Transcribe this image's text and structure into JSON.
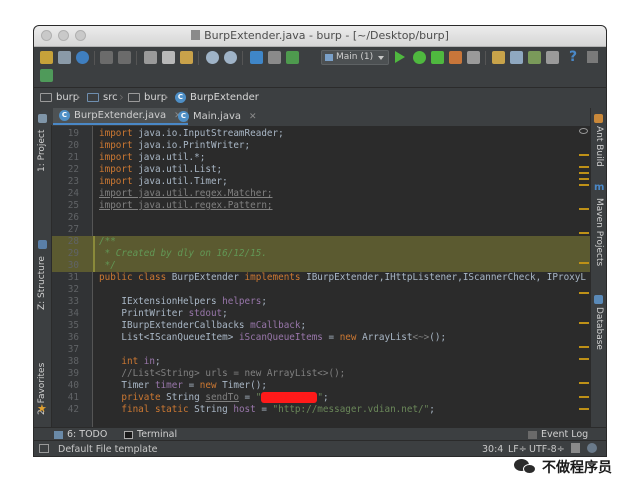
{
  "window": {
    "title": "BurpExtender.java - burp - [~/Desktop/burp]"
  },
  "toolbar": {
    "run_config": "Main (1)"
  },
  "breadcrumbs": [
    "burp",
    "src",
    "burp",
    "BurpExtender"
  ],
  "tabs": [
    {
      "label": "BurpExtender.java",
      "active": true
    },
    {
      "label": "Main.java",
      "active": false
    }
  ],
  "left_tools": {
    "project": "1: Project",
    "structure": "Z: Structure",
    "favorites": "2: Favorites"
  },
  "right_tools": {
    "ant": "Ant Build",
    "maven": "Maven Projects",
    "database": "Database"
  },
  "code_lines": [
    {
      "n": "19",
      "segs": [
        [
          "kw",
          "import "
        ],
        [
          "",
          "java.io.InputStreamReader;"
        ]
      ]
    },
    {
      "n": "20",
      "segs": [
        [
          "kw",
          "import "
        ],
        [
          "",
          "java.io.PrintWriter;"
        ]
      ]
    },
    {
      "n": "21",
      "segs": [
        [
          "kw",
          "import "
        ],
        [
          "",
          "java.util.*;"
        ]
      ]
    },
    {
      "n": "22",
      "segs": [
        [
          "kw",
          "import "
        ],
        [
          "",
          "java.util.List;"
        ]
      ]
    },
    {
      "n": "23",
      "segs": [
        [
          "kw",
          "import "
        ],
        [
          "",
          "java.util.Timer;"
        ]
      ]
    },
    {
      "n": "24",
      "segs": [
        [
          "unused",
          "import java.util.regex.Matcher;"
        ]
      ]
    },
    {
      "n": "25",
      "segs": [
        [
          "unused",
          "import java.util.regex.Pattern;"
        ]
      ]
    },
    {
      "n": "26",
      "segs": []
    },
    {
      "n": "27",
      "segs": []
    },
    {
      "n": "28",
      "segs": [
        [
          "doc",
          "/**"
        ]
      ],
      "hl": true
    },
    {
      "n": "29",
      "segs": [
        [
          "doc",
          " * Created by dly on 16/12/15."
        ]
      ],
      "hl": true
    },
    {
      "n": "30",
      "segs": [
        [
          "doc",
          " */"
        ]
      ],
      "hl": true
    },
    {
      "n": "31",
      "segs": [
        [
          "kw",
          "public class "
        ],
        [
          "",
          "BurpExtender "
        ],
        [
          "kw",
          "implements "
        ],
        [
          "",
          "IBurpExtender,IHttpListener,IScannerCheck, IProxyL"
        ]
      ]
    },
    {
      "n": "32",
      "segs": []
    },
    {
      "n": "33",
      "segs": [
        [
          "",
          "    IExtensionHelpers "
        ],
        [
          "fld",
          "helpers"
        ],
        [
          "",
          ";"
        ]
      ]
    },
    {
      "n": "34",
      "segs": [
        [
          "",
          "    PrintWriter "
        ],
        [
          "fld",
          "stdout"
        ],
        [
          "",
          ";"
        ]
      ]
    },
    {
      "n": "35",
      "segs": [
        [
          "",
          "    IBurpExtenderCallbacks "
        ],
        [
          "fld",
          "mCallback"
        ],
        [
          "",
          ";"
        ]
      ]
    },
    {
      "n": "36",
      "segs": [
        [
          "",
          "    List<IScanQueueItem> "
        ],
        [
          "fld",
          "iScanQueueItems"
        ],
        [
          "",
          " = "
        ],
        [
          "kw",
          "new "
        ],
        [
          "",
          "ArrayList"
        ],
        [
          "gen",
          "<~>"
        ],
        [
          "",
          "();"
        ]
      ]
    },
    {
      "n": "37",
      "segs": []
    },
    {
      "n": "38",
      "segs": [
        [
          "kw",
          "    int "
        ],
        [
          "fld",
          "in"
        ],
        [
          "",
          ";"
        ]
      ]
    },
    {
      "n": "39",
      "segs": [
        [
          "cmt",
          "    //List<String> urls = new ArrayList<>();"
        ]
      ]
    },
    {
      "n": "40",
      "segs": [
        [
          "",
          "    Timer "
        ],
        [
          "fld",
          "timer"
        ],
        [
          "",
          " = "
        ],
        [
          "kw",
          "new "
        ],
        [
          "",
          "Timer();"
        ]
      ]
    },
    {
      "n": "41",
      "segs": [
        [
          "kw",
          "    private "
        ],
        [
          "",
          "String "
        ],
        [
          "unused",
          "sendTo"
        ],
        [
          "",
          " = "
        ],
        [
          "str",
          "\""
        ],
        [
          "redact",
          "xxxxxxxxxx"
        ],
        [
          "str",
          "\""
        ],
        [
          "",
          ";"
        ]
      ]
    },
    {
      "n": "42",
      "segs": [
        [
          "kw",
          "    final static "
        ],
        [
          "",
          "String "
        ],
        [
          "fld",
          "host"
        ],
        [
          "",
          " = "
        ],
        [
          "str",
          "\"http://messager.vdian.net/\""
        ],
        [
          "",
          ";"
        ]
      ]
    }
  ],
  "tool_windows": {
    "todo": "6: TODO",
    "terminal": "Terminal",
    "event_log": "Event Log"
  },
  "status": {
    "message": "Default File template",
    "position": "30:4",
    "line_sep": "LF÷",
    "encoding": "UTF-8÷"
  },
  "watermark": "不做程序员"
}
